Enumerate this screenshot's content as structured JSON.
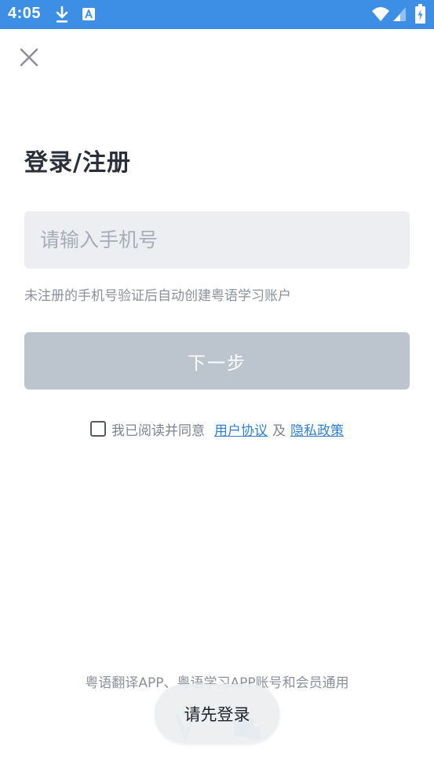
{
  "status_bar": {
    "time": "4:05",
    "icons": [
      "download-icon",
      "text-a-icon",
      "wifi-icon",
      "signal-icon",
      "battery-charging-icon"
    ]
  },
  "header": {
    "close_icon": "close-icon"
  },
  "login": {
    "title": "登录/注册",
    "phone_placeholder": "请输入手机号",
    "phone_value": "",
    "hint": "未注册的手机号验证后自动创建粤语学习账户",
    "next_label": "下一步"
  },
  "agreement": {
    "checked": false,
    "prefix": "我已阅读并同意",
    "user_agreement": "用户协议",
    "conjunction": "及",
    "privacy_policy": "隐私政策"
  },
  "footer": {
    "note": "粤语翻译APP、粤语学习APP账号和会员通用"
  },
  "toast": {
    "message": "请先登录"
  },
  "colors": {
    "status_bar": "#3d8fe6",
    "link": "#2f7fd6",
    "button_disabled": "#bcc4ce",
    "input_bg": "#eceef2"
  }
}
